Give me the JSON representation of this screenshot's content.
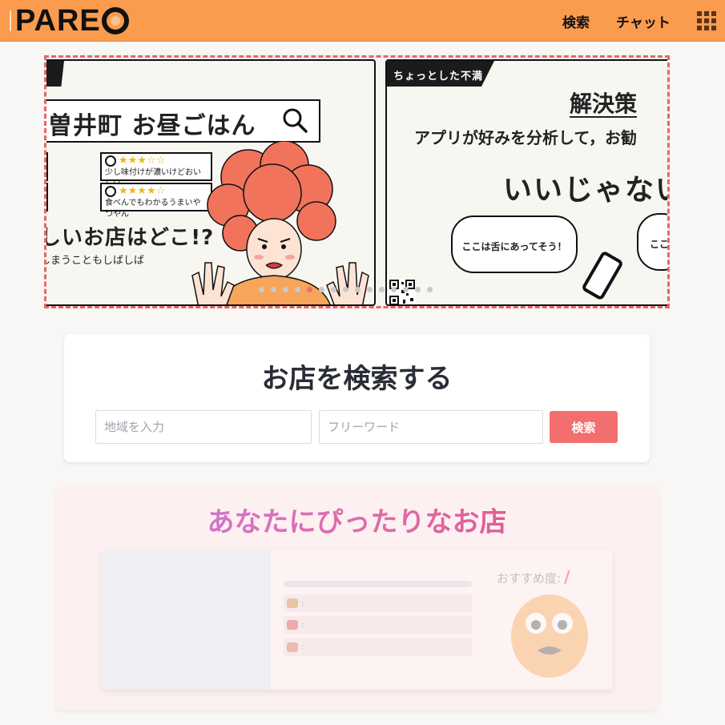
{
  "header": {
    "logo_text": "PAREO",
    "nav": {
      "search": "検索",
      "chat": "チャット"
    },
    "menu_icon": "grid-icon",
    "background_color": "#fb9b4e"
  },
  "carousel": {
    "slides": [
      {
        "search_text": "曽井町 お昼ごはん",
        "reviews": [
          {
            "stars": "★★★☆☆",
            "text": "少し味付けが濃いけどおいしい"
          },
          {
            "stars": "★★★★☆",
            "text": "食べんでもわかるうまいやつやん"
          }
        ],
        "review_left_fragments": [
          "!",
          "い"
        ],
        "headline": "しいお店はどこ!?",
        "sub": "しまうこともしばしば"
      },
      {
        "tag": "ちょっとした不満",
        "title": "解決策",
        "line": "アプリが好みを分析して，お勧",
        "big": "いいじゃない",
        "bubble1": "ここは舌にあってそう！",
        "bubble2": "ここ"
      }
    ],
    "dot_count": 15,
    "active_dot": 4
  },
  "search": {
    "title": "お店を検索する",
    "area_placeholder": "地域を入力",
    "word_placeholder": "フリーワード",
    "button_label": "検索"
  },
  "recommend": {
    "title": "あなたにぴったりなお店",
    "score_label": "おすすめ度:",
    "score_value": "/",
    "rows": [
      ":",
      ":",
      ":"
    ]
  }
}
